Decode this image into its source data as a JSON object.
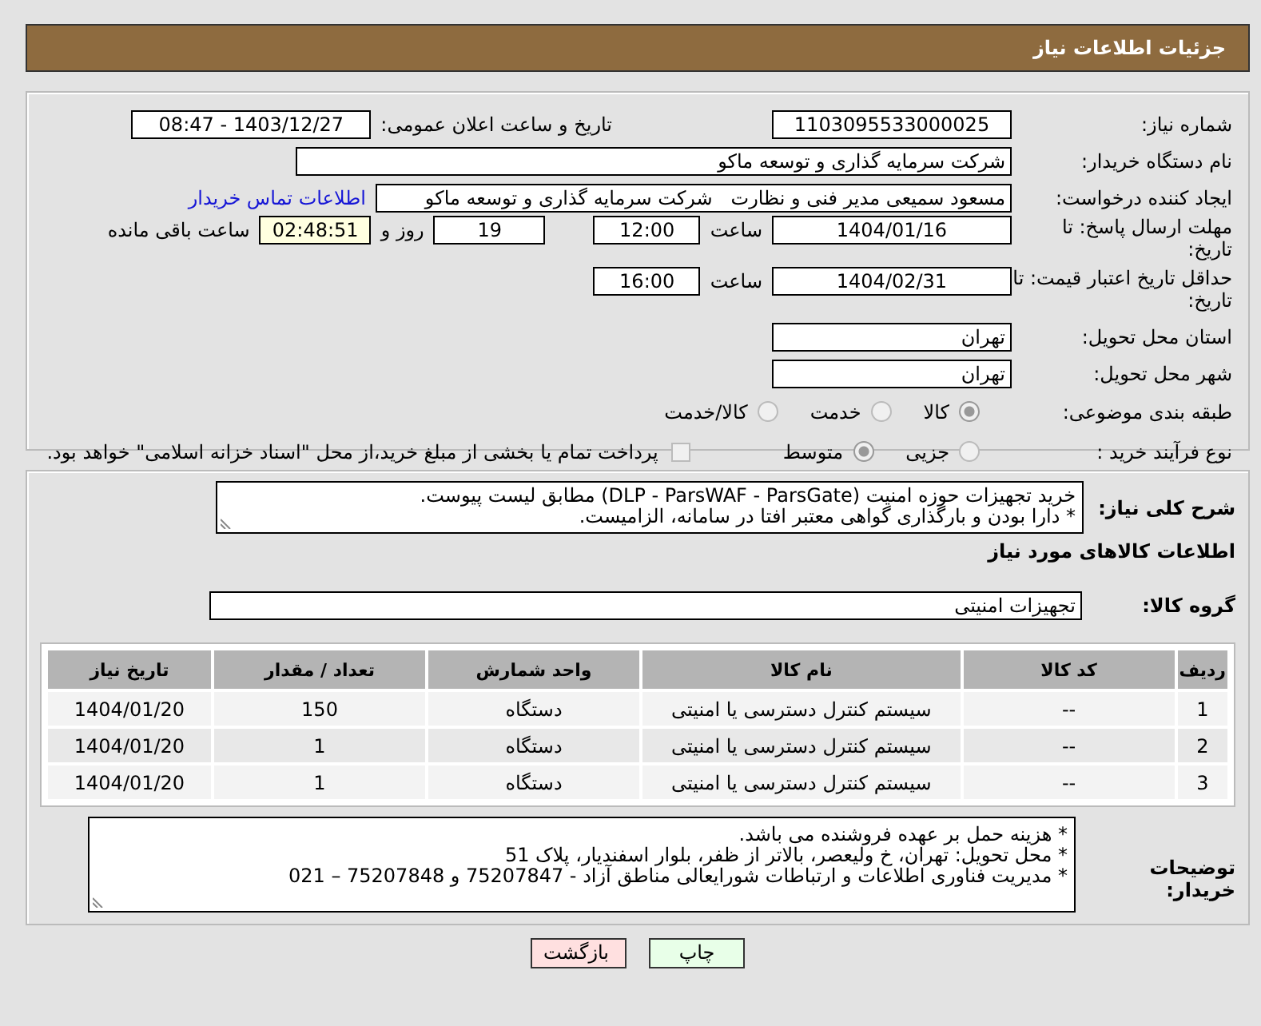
{
  "header": {
    "title": "جزئیات اطلاعات نیاز"
  },
  "form": {
    "need_number": {
      "label": "شماره نیاز:",
      "value": "1103095533000025"
    },
    "announce": {
      "label": "تاریخ و ساعت اعلان عمومی:",
      "value": "1403/12/27 - 08:47"
    },
    "buyer_org": {
      "label": "نام دستگاه خریدار:",
      "value": "شرکت سرمایه گذاری و توسعه ماکو"
    },
    "creator": {
      "label": "ایجاد کننده درخواست:",
      "value": "مسعود سمیعی مدیر فنی و نظارت   شرکت سرمایه گذاری و توسعه ماکو",
      "link": "اطلاعات تماس خریدار"
    },
    "reply_deadline": {
      "label": "مهلت ارسال پاسخ: تا تاریخ:",
      "date": "1404/01/16",
      "time_label": "ساعت",
      "time": "12:00",
      "days": "19",
      "days_label": "روز و",
      "remaining": "02:48:51",
      "remaining_label": "ساعت باقی مانده"
    },
    "price_validity": {
      "label": "حداقل تاریخ اعتبار قیمت: تا تاریخ:",
      "date": "1404/02/31",
      "time_label": "ساعت",
      "time": "16:00"
    },
    "province": {
      "label": "استان محل تحویل:",
      "value": "تهران"
    },
    "city": {
      "label": "شهر محل تحویل:",
      "value": "تهران"
    },
    "category": {
      "label": "طبقه بندی موضوعی:",
      "options": [
        {
          "label": "کالا",
          "selected": true
        },
        {
          "label": "خدمت",
          "selected": false
        },
        {
          "label": "کالا/خدمت",
          "selected": false
        }
      ]
    },
    "process": {
      "label": "نوع فرآیند خرید :",
      "options": [
        {
          "label": "جزیی",
          "selected": false
        },
        {
          "label": "متوسط",
          "selected": true
        }
      ],
      "payment_checkbox": {
        "checked": false,
        "label": "پرداخت تمام یا بخشی از مبلغ خرید،از محل \"اسناد خزانه اسلامی\" خواهد بود."
      }
    }
  },
  "description": {
    "label": "شرح کلی نیاز:",
    "lines": [
      "خرید تجهیزات حوزه امنیت (DLP - ParsWAF - ParsGate) مطابق لیست پیوست.",
      "* دارا بودن و بارگذاری گواهی معتبر افتا در سامانه، الزامیست."
    ]
  },
  "goods": {
    "title": "اطلاعات کالاهای مورد نیاز",
    "group_label": "گروه کالا:",
    "group_value": "تجهیزات امنیتی",
    "table": {
      "columns": [
        "ردیف",
        "کد کالا",
        "نام کالا",
        "واحد شمارش",
        "تعداد / مقدار",
        "تاریخ نیاز"
      ],
      "rows": [
        [
          "1",
          "--",
          "سیستم کنترل دسترسی یا امنیتی",
          "دستگاه",
          "150",
          "1404/01/20"
        ],
        [
          "2",
          "--",
          "سیستم کنترل دسترسی یا امنیتی",
          "دستگاه",
          "1",
          "1404/01/20"
        ],
        [
          "3",
          "--",
          "سیستم کنترل دسترسی یا امنیتی",
          "دستگاه",
          "1",
          "1404/01/20"
        ]
      ]
    }
  },
  "buyer_notes": {
    "label": "توضیحات خریدار:",
    "lines": [
      "* هزینه حمل بر عهده فروشنده می باشد.",
      "* محل تحویل: تهران، خ ولیعصر، بالاتر از ظفر، بلوار اسفندیار، پلاک 51",
      "* مدیریت فناوری اطلاعات و ارتباطات شورایعالی مناطق آزاد - 75207847 و 75207848 – 021"
    ]
  },
  "buttons": [
    {
      "label": "چاپ",
      "kind": "print"
    },
    {
      "label": "بازگشت",
      "kind": "back"
    }
  ]
}
